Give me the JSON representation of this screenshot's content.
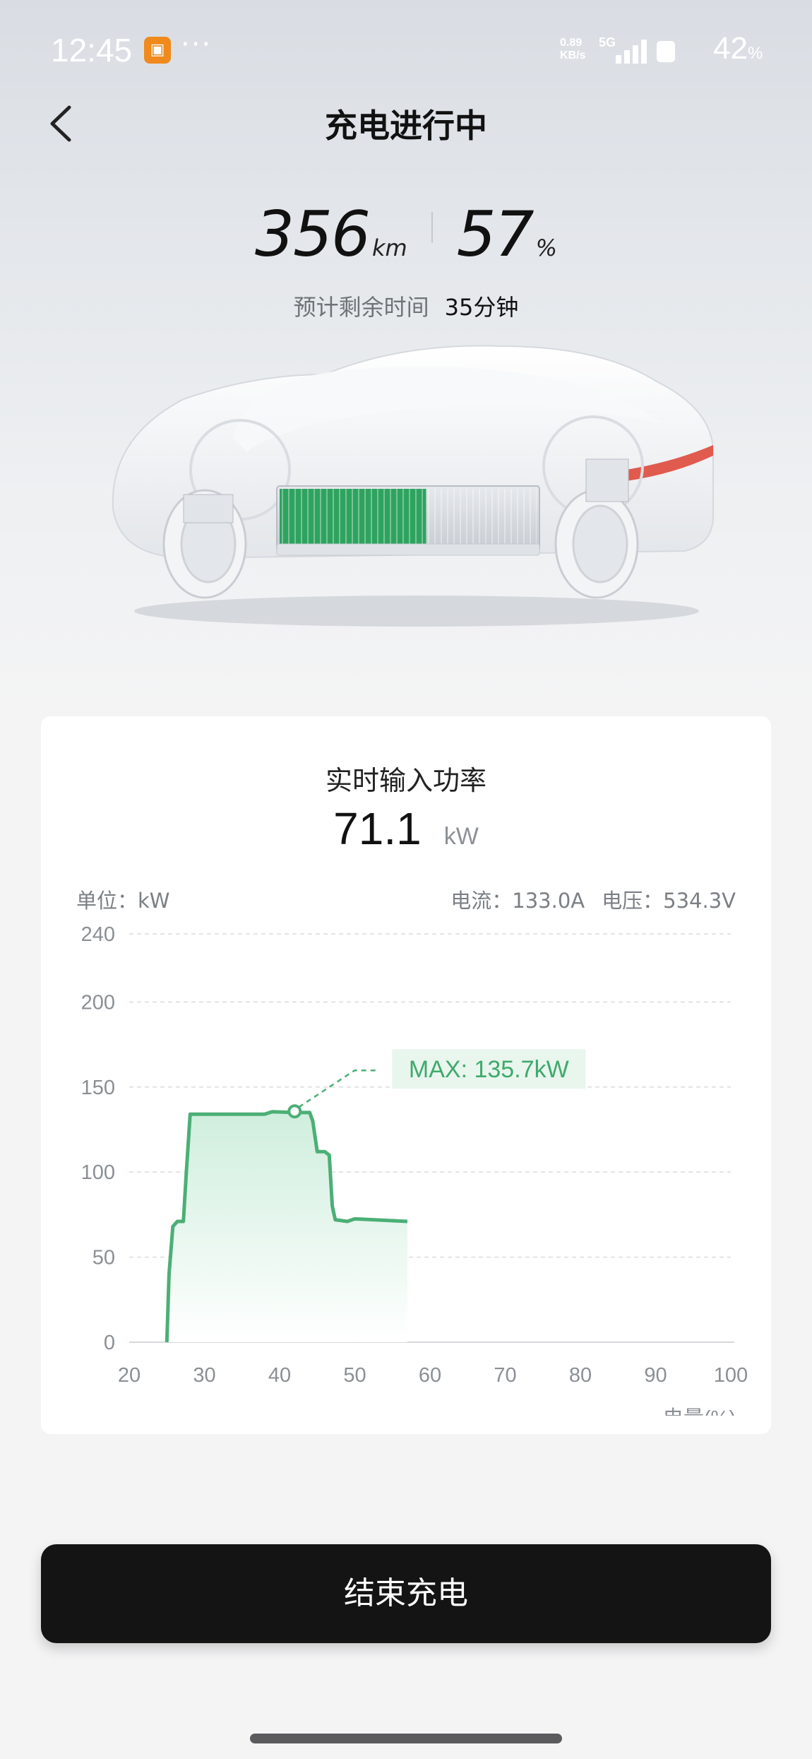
{
  "status_bar": {
    "time": "12:45",
    "net_speed_value": "0.89",
    "net_speed_unit": "KB/s",
    "network": "5G",
    "battery": "42",
    "battery_unit": "%"
  },
  "header": {
    "title": "充电进行中"
  },
  "summary": {
    "range_value": "356",
    "range_unit": "km",
    "soc_value": "57",
    "soc_unit": "%",
    "eta_label": "预计剩余时间",
    "eta_value": "35分钟",
    "battery_fill_fraction": 0.57
  },
  "power_card": {
    "title": "实时输入功率",
    "power_value": "71.1",
    "power_unit": "kW",
    "unit_label": "单位：kW",
    "current": "电流：133.0A",
    "voltage": "电压：534.3V",
    "max_tag": "MAX: 135.7kW"
  },
  "chart_data": {
    "type": "area",
    "xlabel": "电量(%)",
    "ylabel": "单位：kW",
    "x_ticks": [
      20,
      30,
      40,
      50,
      60,
      70,
      80,
      90,
      100
    ],
    "y_ticks": [
      0,
      50,
      100,
      150,
      200,
      240
    ],
    "xlim": [
      20,
      100
    ],
    "ylim": [
      0,
      240
    ],
    "grid": true,
    "color": "#4caf76",
    "x": [
      25,
      25.3,
      25.8,
      26.4,
      27.2,
      27.6,
      28.1,
      30,
      35,
      38,
      39,
      42,
      44,
      44.4,
      45,
      46,
      46.6,
      47,
      47.4,
      49,
      50,
      57
    ],
    "y": [
      0,
      40,
      68,
      71,
      71,
      100,
      134,
      134,
      134,
      134,
      135.5,
      135,
      135,
      130,
      112,
      112,
      110,
      80,
      72,
      71,
      72.5,
      71
    ],
    "max_point": {
      "x": 42,
      "y": 135.7,
      "label": "MAX: 135.7kW"
    }
  },
  "actions": {
    "end_label": "结束充电"
  },
  "colors": {
    "accent_green": "#2ea35f",
    "chart_line": "#4caf76",
    "button_bg": "#141414",
    "status_orange": "#f08a1c"
  }
}
